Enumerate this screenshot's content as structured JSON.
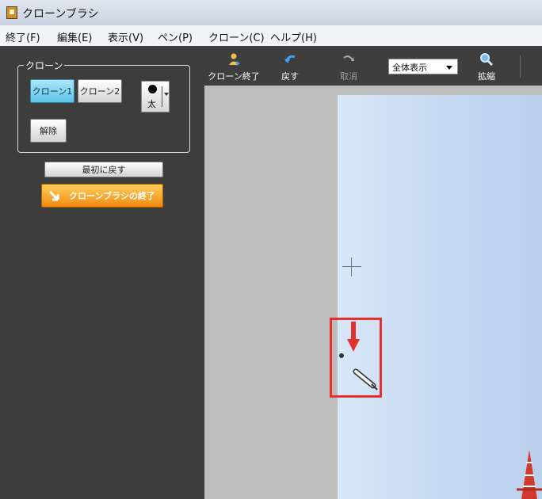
{
  "window": {
    "title": "クローンブラシ"
  },
  "menu": [
    "終了(F)",
    "編集(E)",
    "表示(V)",
    "ペン(P)",
    "クローン(C)",
    "ヘルプ(H)"
  ],
  "panel": {
    "group_label": "クローン",
    "clone1": "クローン1",
    "clone2": "クローン2",
    "release": "解除",
    "pen_size": "太",
    "reset": "最初に戻す",
    "finish": "クローンブラシの終了"
  },
  "toolbar": {
    "end_clone": "クローン終了",
    "undo": "戻す",
    "cancel": "取消",
    "zoom_value": "全体表示",
    "enlarge": "拡縮"
  },
  "colors": {
    "panel_bg": "#3d3d3d",
    "canvas_bg": "#bdbdbd",
    "accent_blue": "#5bc4ea",
    "accent_orange": "#f08a12",
    "highlight_red": "#e53030"
  },
  "icons": [
    "app-icon",
    "end-clone-icon",
    "undo-icon",
    "cancel-icon",
    "zoom-icon",
    "red-arrow-icon",
    "pen-cursor-icon",
    "crosshair-icon"
  ]
}
